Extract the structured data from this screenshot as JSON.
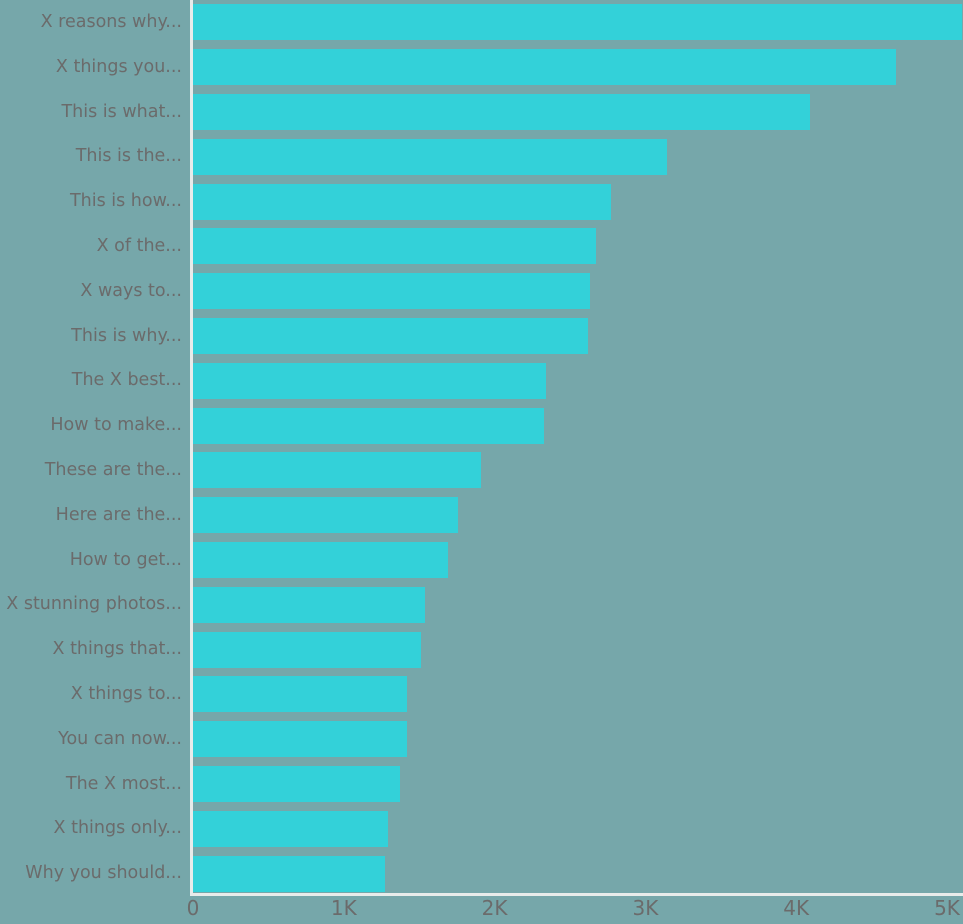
{
  "chart_data": {
    "type": "bar",
    "orientation": "horizontal",
    "title": "",
    "xlabel": "",
    "ylabel": "",
    "xlim": [
      0,
      5000
    ],
    "grid": false,
    "legend": null,
    "bar_color": "#33d1d9",
    "background_color": "#76a7aa",
    "label_color": "#6b6b6b",
    "axis_color": "#e8eceb",
    "xticks": [
      {
        "label": "0",
        "value": 0
      },
      {
        "label": "1K",
        "value": 1000
      },
      {
        "label": "2K",
        "value": 2000
      },
      {
        "label": "3K",
        "value": 3000
      },
      {
        "label": "4K",
        "value": 4000
      },
      {
        "label": "5K",
        "value": 5000
      }
    ],
    "categories": [
      "X reasons why...",
      "X things you...",
      "This is what...",
      "This is the...",
      "This is how...",
      "X of the...",
      "X ways to...",
      "This is why...",
      "The X best...",
      "How to make...",
      "These are the...",
      "Here are the...",
      "How to get...",
      "X stunning photos...",
      "X things that...",
      "X things to...",
      "You can now...",
      "The X most...",
      "X things only...",
      "Why you should..."
    ],
    "values": [
      5100,
      4660,
      4090,
      3140,
      2770,
      2670,
      2630,
      2620,
      2340,
      2330,
      1910,
      1760,
      1690,
      1540,
      1510,
      1420,
      1420,
      1370,
      1290,
      1270
    ]
  }
}
